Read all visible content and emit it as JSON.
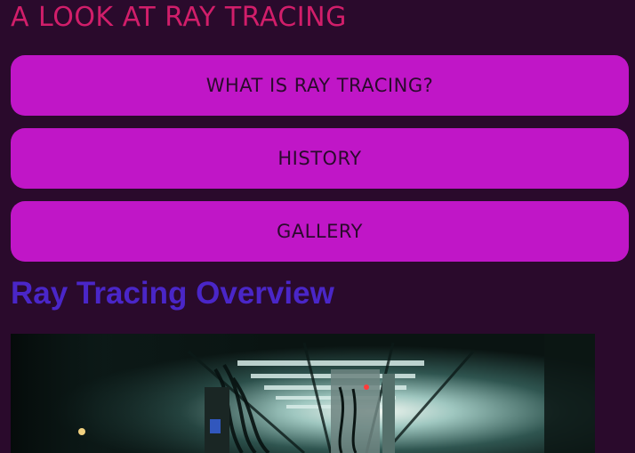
{
  "header": {
    "title": "A LOOK AT RAY TRACING"
  },
  "nav": {
    "buttons": [
      {
        "label": "WHAT IS RAY TRACING?"
      },
      {
        "label": "HISTORY"
      },
      {
        "label": "GALLERY"
      }
    ]
  },
  "main": {
    "heading": "Ray Tracing Overview",
    "image": {
      "icon": "photo-corridor-image"
    }
  },
  "colors": {
    "background": "#2a0a2c",
    "title": "#d11e6a",
    "button_bg": "#c016c7",
    "button_text": "#2a0a2c",
    "heading": "#4a26c8"
  }
}
